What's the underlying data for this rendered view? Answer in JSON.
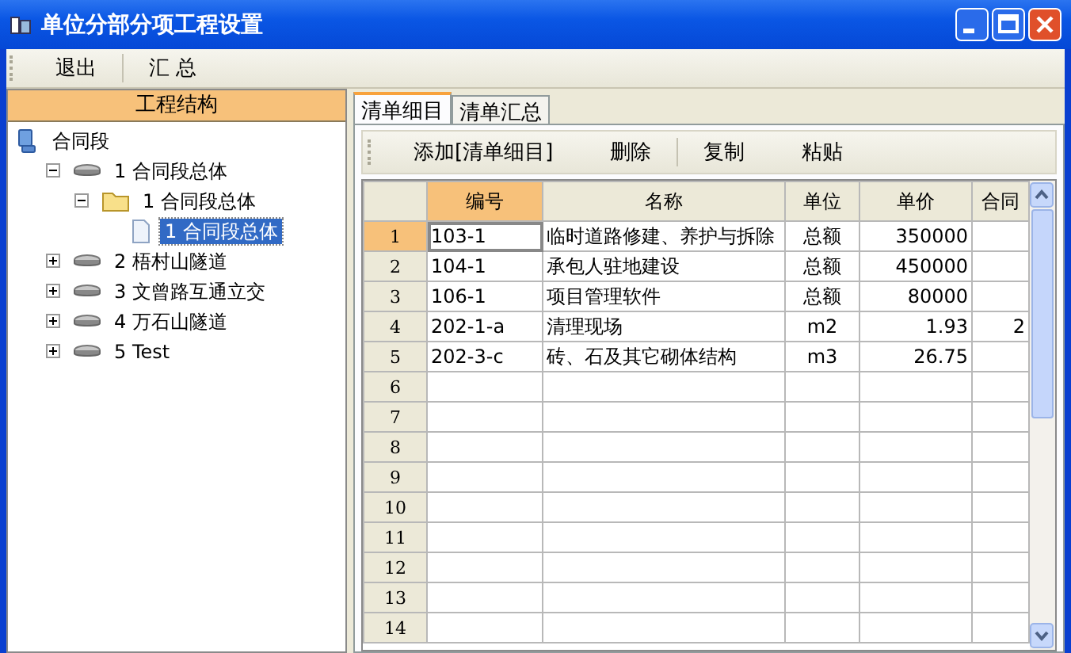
{
  "window": {
    "title": "单位分部分项工程设置"
  },
  "toolbar": [
    "退出",
    "汇 总"
  ],
  "tree": {
    "title": "工程结构",
    "items": [
      {
        "label": "合同段",
        "kind": "root",
        "expanded": true,
        "selected": false,
        "children": [
          {
            "label": "1 合同段总体",
            "kind": "disk",
            "expanded": true,
            "selected": false,
            "children": [
              {
                "label": "1 合同段总体",
                "kind": "folder",
                "expanded": true,
                "selected": false,
                "children": [
                  {
                    "label": "1 合同段总体",
                    "kind": "doc",
                    "selected": true
                  }
                ]
              }
            ]
          },
          {
            "label": "2 梧村山隧道",
            "kind": "disk",
            "expanded": false,
            "selected": false
          },
          {
            "label": "3 文曾路互通立交",
            "kind": "disk",
            "expanded": false,
            "selected": false
          },
          {
            "label": "4 万石山隧道",
            "kind": "disk",
            "expanded": false,
            "selected": false
          },
          {
            "label": "5 Test",
            "kind": "disk",
            "expanded": false,
            "selected": false
          }
        ]
      }
    ]
  },
  "tabs": [
    {
      "label": "清单细目",
      "selected": true
    },
    {
      "label": "清单汇总",
      "selected": false
    }
  ],
  "actions": [
    "添加[清单细目]",
    "删除",
    "复制",
    "粘贴"
  ],
  "table": {
    "columns": [
      {
        "label": "编号",
        "selected": true
      },
      {
        "label": "名称",
        "selected": false
      },
      {
        "label": "单位",
        "selected": false
      },
      {
        "label": "单价",
        "selected": false
      },
      {
        "label": "合同",
        "selected": false
      }
    ],
    "rows": [
      {
        "number": "1",
        "selected": true,
        "cells": [
          "103-1",
          "临时道路修建、养护与拆除",
          "总额",
          "350000"
        ]
      },
      {
        "number": "2",
        "selected": false,
        "cells": [
          "104-1",
          "承包人驻地建设",
          "总额",
          "450000"
        ]
      },
      {
        "number": "3",
        "selected": false,
        "cells": [
          "106-1",
          "项目管理软件",
          "总额",
          "80000"
        ]
      },
      {
        "number": "4",
        "selected": false,
        "cells": [
          "202-1-a",
          "清理现场",
          "m2",
          "1.93",
          "2"
        ]
      },
      {
        "number": "5",
        "selected": false,
        "cells": [
          "202-3-c",
          "砖、石及其它砌体结构",
          "m3",
          "26.75"
        ]
      },
      {
        "number": "6",
        "selected": false
      },
      {
        "number": "7",
        "selected": false
      },
      {
        "number": "8",
        "selected": false
      },
      {
        "number": "9",
        "selected": false
      },
      {
        "number": "10",
        "selected": false
      },
      {
        "number": "11",
        "selected": false
      },
      {
        "number": "12",
        "selected": false
      },
      {
        "number": "13",
        "selected": false
      },
      {
        "number": "14",
        "selected": false
      }
    ]
  }
}
